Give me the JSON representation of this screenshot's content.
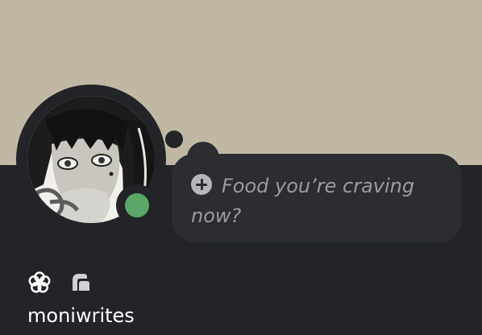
{
  "profile": {
    "banner_color": "#c0b8a5",
    "status": "online",
    "status_color": "#5aa768",
    "avatar_description_icon": "anime-portrait-avatar",
    "thought_bubble": {
      "icon": "add-circle-icon",
      "text": "Food you’re craving now?"
    },
    "badges": [
      {
        "icon": "flower-badge-icon"
      },
      {
        "icon": "quest-badge-icon"
      }
    ],
    "username": "moniwrites"
  }
}
